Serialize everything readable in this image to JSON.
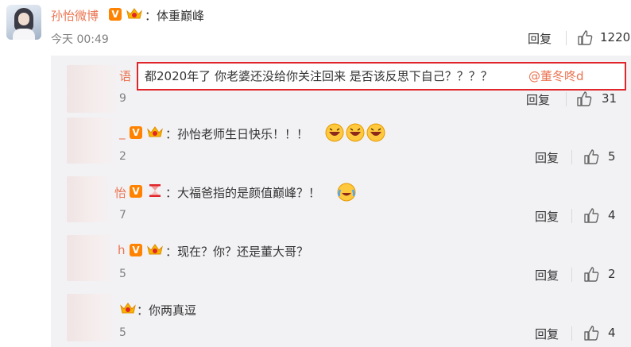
{
  "post": {
    "author": "孙怡微博",
    "verified_badge": "V",
    "content": "：体重巅峰",
    "time": "今天 00:49",
    "reply_label": "回复",
    "like_count": "1220"
  },
  "replies": [
    {
      "name_tail": "语",
      "content": "都2020年了 你老婆还没给你关注回来 是否该反思下自己？？？？",
      "mention": "@董冬咚d",
      "time_tail": "9",
      "reply_label": "回复",
      "like_count": "31"
    },
    {
      "name_tail": "_",
      "content": "：孙怡老师生日快乐！！！",
      "time_tail": "2",
      "reply_label": "回复",
      "like_count": "5"
    },
    {
      "name_tail": "怡",
      "content": "：大福爸指的是颜值巅峰？！",
      "time_tail": "7",
      "reply_label": "回复",
      "like_count": "4"
    },
    {
      "name_tail": "h",
      "content": "：现在？你？还是董大哥？",
      "time_tail": "5",
      "reply_label": "回复",
      "like_count": "2"
    },
    {
      "name_tail": "",
      "content": "：你两真逗",
      "time_tail": "5",
      "reply_label": "回复",
      "like_count": "4"
    }
  ],
  "icons": {
    "accent": "#eb7350",
    "badge_color": "#ff8200",
    "highlight_border": "#e0262b"
  }
}
